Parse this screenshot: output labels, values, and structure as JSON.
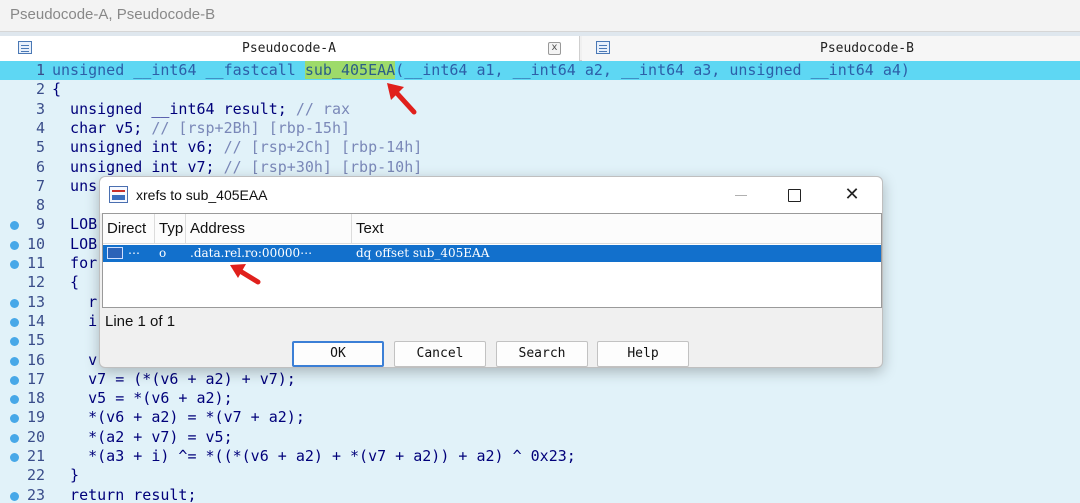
{
  "window": {
    "title": "Pseudocode-A, Pseudocode-B"
  },
  "tabs": [
    {
      "label": "Pseudocode-A",
      "close": "x"
    },
    {
      "label": "Pseudocode-B"
    }
  ],
  "code": {
    "lines": [
      {
        "n": "1",
        "pre": "unsigned __int64 __fastcall ",
        "fn": "sub_405EAA",
        "post": "(__int64 a1, __int64 a2, __int64 a3, unsigned __int64 a4)"
      },
      {
        "n": "2",
        "code": "{"
      },
      {
        "n": "3",
        "code": "  unsigned __int64 result; ",
        "comment": "// rax"
      },
      {
        "n": "4",
        "code": "  char v5; ",
        "comment": "// [rsp+2Bh] [rbp-15h]"
      },
      {
        "n": "5",
        "code": "  unsigned int v6; ",
        "comment": "// [rsp+2Ch] [rbp-14h]"
      },
      {
        "n": "6",
        "code": "  unsigned int v7; ",
        "comment": "// [rsp+30h] [rbp-10h]"
      },
      {
        "n": "7",
        "code": "  uns"
      },
      {
        "n": "8",
        "code": ""
      },
      {
        "n": "9",
        "code": "  LOB"
      },
      {
        "n": "10",
        "code": "  LOB"
      },
      {
        "n": "11",
        "code": "  for"
      },
      {
        "n": "12",
        "code": "  {"
      },
      {
        "n": "13",
        "code": "    r"
      },
      {
        "n": "14",
        "code": "    i"
      },
      {
        "n": "15",
        "code": ""
      },
      {
        "n": "16",
        "code": "    v"
      },
      {
        "n": "17",
        "code": "    v7 = (*(v6 + a2) + v7);"
      },
      {
        "n": "18",
        "code": "    v5 = *(v6 + a2);"
      },
      {
        "n": "19",
        "code": "    *(v6 + a2) = *(v7 + a2);"
      },
      {
        "n": "20",
        "code": "    *(a2 + v7) = v5;"
      },
      {
        "n": "21",
        "code": "    *(a3 + i) ^= *((*(v6 + a2) + *(v7 + a2)) + a2) ^ 0x23;"
      },
      {
        "n": "22",
        "code": "  }"
      },
      {
        "n": "23",
        "code": "  return result;"
      }
    ]
  },
  "dialog": {
    "title": "xrefs to sub_405EAA",
    "columns": [
      "Direct",
      "Typ",
      "Address",
      "Text"
    ],
    "rows": [
      {
        "direction": "⋯",
        "type": "o",
        "address": ".data.rel.ro:00000⋯",
        "text": "dq offset sub_405EAA"
      }
    ],
    "status": "Line 1 of 1",
    "buttons": {
      "ok": "OK",
      "cancel": "Cancel",
      "search": "Search",
      "help": "Help"
    }
  },
  "colors": {
    "code_bg": "#e1f2f9",
    "line_highlight": "#5ed7f3",
    "function_highlight": "#9edb6a",
    "selection": "#1270cc",
    "annotation_arrow": "#e0201c"
  }
}
